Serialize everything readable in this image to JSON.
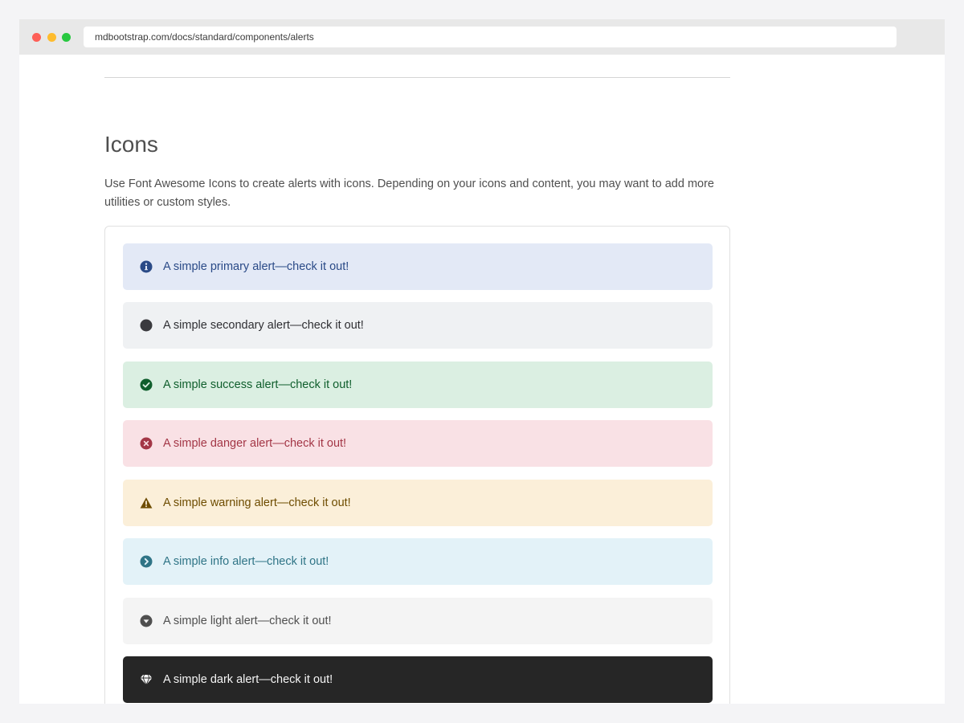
{
  "browser": {
    "url": "mdbootstrap.com/docs/standard/components/alerts"
  },
  "section": {
    "title": "Icons",
    "description": "Use Font Awesome Icons to create alerts with icons. Depending on your icons and content, you may want to add more utilities or custom styles."
  },
  "alerts": [
    {
      "variant": "primary",
      "text": "A simple primary alert—check it out!",
      "icon": "info-circle-icon",
      "bg": "#e3e9f6",
      "fg": "#2a4a87"
    },
    {
      "variant": "secondary",
      "text": "A simple secondary alert—check it out!",
      "icon": "filled-circle-icon",
      "bg": "#eff1f3",
      "fg": "#2f2f33"
    },
    {
      "variant": "success",
      "text": "A simple success alert—check it out!",
      "icon": "check-circle-icon",
      "bg": "#dbefe2",
      "fg": "#0f5e2c"
    },
    {
      "variant": "danger",
      "text": "A simple danger alert—check it out!",
      "icon": "times-circle-icon",
      "bg": "#f9e1e5",
      "fg": "#a33646"
    },
    {
      "variant": "warning",
      "text": "A simple warning alert—check it out!",
      "icon": "exclamation-triangle-icon",
      "bg": "#fbefd9",
      "fg": "#6e4c00"
    },
    {
      "variant": "info",
      "text": "A simple info alert—check it out!",
      "icon": "chevron-circle-right-icon",
      "bg": "#e3f2f8",
      "fg": "#2f7486"
    },
    {
      "variant": "light",
      "text": "A simple light alert—check it out!",
      "icon": "chevron-circle-down-icon",
      "bg": "#f4f4f4",
      "fg": "#4f4f4f"
    },
    {
      "variant": "dark",
      "text": "A simple dark alert—check it out!",
      "icon": "gem-icon",
      "bg": "#262626",
      "fg": "#f5f5f5"
    }
  ]
}
